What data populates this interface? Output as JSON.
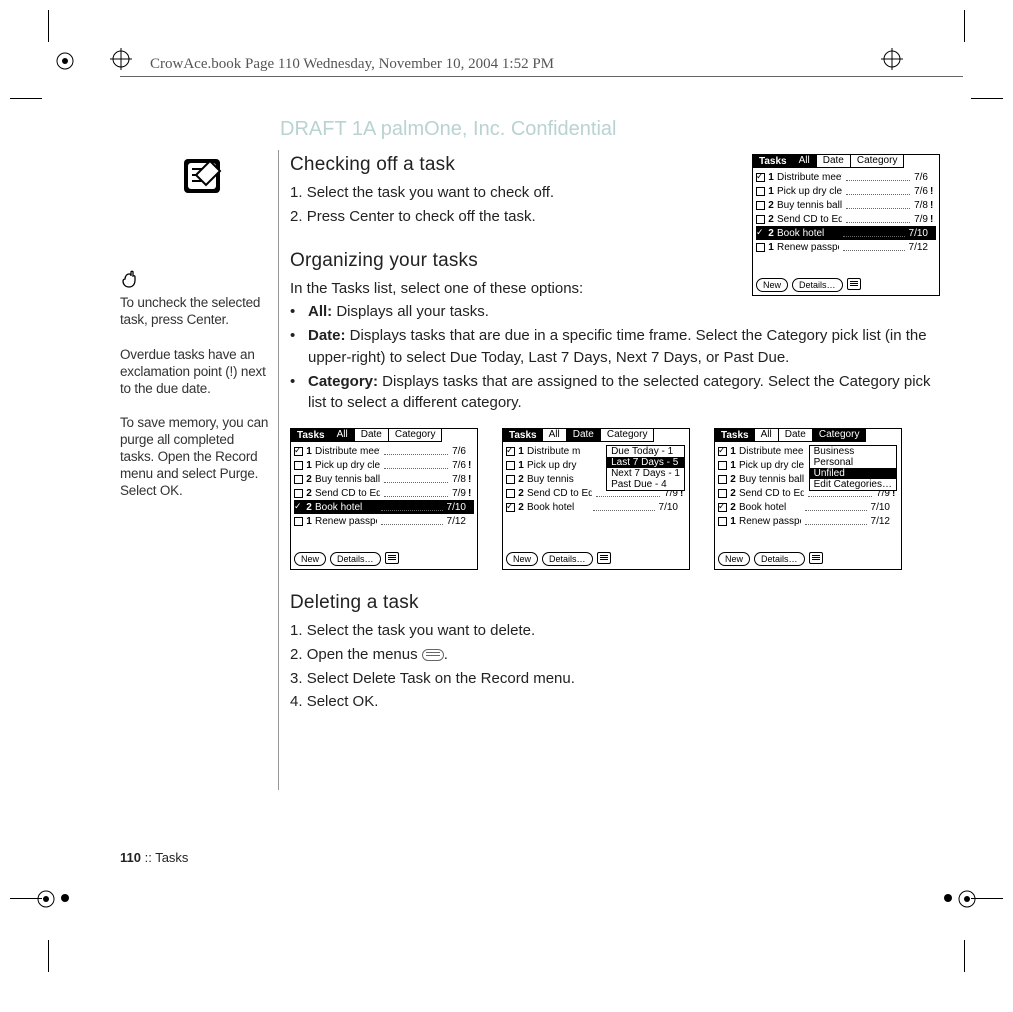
{
  "meta": {
    "running_head": "CrowAce.book  Page 110  Wednesday, November 10, 2004  1:52 PM",
    "draft_stamp": "DRAFT 1A  palmOne, Inc.   Confidential"
  },
  "sidebar": {
    "tip1": "To uncheck the selected task, press Center.",
    "tip2": "Overdue tasks have an exclamation point (!) next to the due date.",
    "tip3": "To save memory, you can purge all completed tasks. Open the Record menu and select Purge. Select OK."
  },
  "sections": {
    "checking": {
      "heading": "Checking off a task",
      "steps": [
        "Select the task you want to check off.",
        "Press Center to check off the task."
      ]
    },
    "organizing": {
      "heading": "Organizing your tasks",
      "intro": "In the Tasks list, select one of these options:",
      "opts": {
        "all_label": "All:",
        "all_text": " Displays all your tasks.",
        "date_label": "Date:",
        "date_text": " Displays tasks that are due in a specific time frame. Select the Category pick list (in the upper-right) to select Due Today, Last 7 Days, Next 7 Days, or Past Due.",
        "cat_label": "Category:",
        "cat_text": " Displays tasks that are assigned to the selected category. Select the Category pick list to select a different category."
      }
    },
    "deleting": {
      "heading": "Deleting a task",
      "steps_a": "Select the task you want to delete.",
      "steps_b": "Open the menus ",
      "steps_b2": ".",
      "steps_c": "Select Delete Task on the Record menu.",
      "steps_d": "Select OK."
    }
  },
  "palm": {
    "title": "Tasks",
    "tabs": {
      "all": "All",
      "date": "Date",
      "category": "Category"
    },
    "buttons": {
      "new": "New",
      "details": "Details…"
    },
    "rows": [
      {
        "chk": true,
        "pri": "1",
        "text": "Distribute meeting notes",
        "date": "7/6",
        "bang": ""
      },
      {
        "chk": false,
        "pri": "1",
        "text": "Pick up dry cleaning",
        "date": "7/6",
        "bang": "!"
      },
      {
        "chk": false,
        "pri": "2",
        "text": "Buy tennis balls",
        "date": "7/8",
        "bang": "!"
      },
      {
        "chk": false,
        "pri": "2",
        "text": "Send CD to Eddy",
        "date": "7/9",
        "bang": "!"
      },
      {
        "chk": true,
        "pri": "2",
        "text": "Book hotel",
        "date": "7/10",
        "bang": ""
      },
      {
        "chk": false,
        "pri": "1",
        "text": "Renew passport",
        "date": "7/12",
        "bang": ""
      }
    ],
    "date_menu": [
      "Due Today - 1",
      "Last 7 Days - 5",
      "Next 7 Days - 1",
      "Past Due - 4"
    ],
    "date_rows": [
      {
        "chk": true,
        "pri": "1",
        "text": "Distribute m",
        "date": "",
        "bang": ""
      },
      {
        "chk": false,
        "pri": "1",
        "text": "Pick up dry",
        "date": "",
        "bang": ""
      },
      {
        "chk": false,
        "pri": "2",
        "text": "Buy tennis",
        "date": "",
        "bang": ""
      },
      {
        "chk": false,
        "pri": "2",
        "text": "Send CD to Eddy",
        "date": "7/9",
        "bang": "!"
      },
      {
        "chk": true,
        "pri": "2",
        "text": "Book hotel",
        "date": "7/10",
        "bang": ""
      }
    ],
    "cat_menu": [
      "Business",
      "Personal",
      "Unfiled",
      "Edit Categories…"
    ],
    "cat_rows": [
      {
        "chk": true,
        "pri": "1",
        "text": "Distribute mee",
        "date": "",
        "bang": ""
      },
      {
        "chk": false,
        "pri": "1",
        "text": "Pick up dry cle",
        "date": "",
        "bang": ""
      },
      {
        "chk": false,
        "pri": "2",
        "text": "Buy tennis ball",
        "date": "",
        "bang": ""
      },
      {
        "chk": false,
        "pri": "2",
        "text": "Send CD to Eddy",
        "date": "7/9",
        "bang": "!"
      },
      {
        "chk": true,
        "pri": "2",
        "text": "Book hotel",
        "date": "7/10",
        "bang": ""
      },
      {
        "chk": false,
        "pri": "1",
        "text": "Renew passport",
        "date": "7/12",
        "bang": ""
      }
    ]
  },
  "footer": {
    "page_no": "110",
    "sep": "   ::   ",
    "chapter": "Tasks"
  }
}
